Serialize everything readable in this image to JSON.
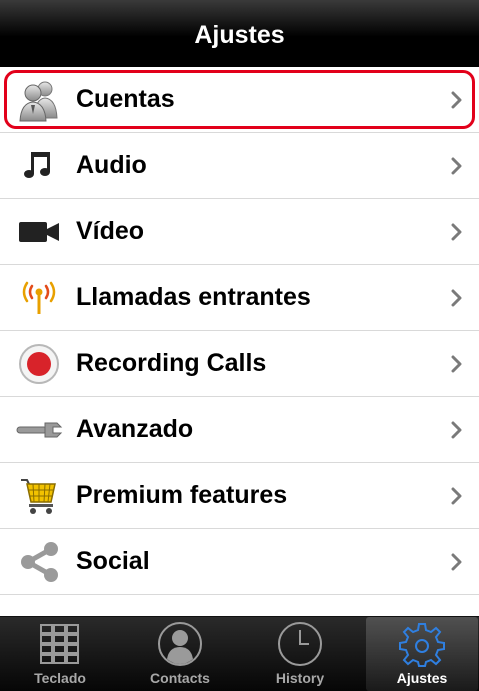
{
  "navbar": {
    "title": "Ajustes"
  },
  "settings": {
    "items": [
      {
        "label": "Cuentas",
        "icon": "accounts-icon"
      },
      {
        "label": "Audio",
        "icon": "music-note-icon"
      },
      {
        "label": "Vídeo",
        "icon": "video-camera-icon"
      },
      {
        "label": "Llamadas entrantes",
        "icon": "antenna-icon"
      },
      {
        "label": "Recording Calls",
        "icon": "record-icon"
      },
      {
        "label": "Avanzado",
        "icon": "wrench-icon"
      },
      {
        "label": "Premium features",
        "icon": "shopping-cart-icon"
      },
      {
        "label": "Social",
        "icon": "share-icon"
      }
    ]
  },
  "tabbar": {
    "tabs": [
      {
        "label": "Teclado",
        "icon": "keypad-icon"
      },
      {
        "label": "Contacts",
        "icon": "contacts-icon"
      },
      {
        "label": "History",
        "icon": "clock-icon"
      },
      {
        "label": "Ajustes",
        "icon": "gear-icon"
      }
    ],
    "active": "Ajustes"
  },
  "colors": {
    "highlight": "#e2001a",
    "record_red": "#d8232a",
    "cart_yellow": "#f2c200"
  }
}
